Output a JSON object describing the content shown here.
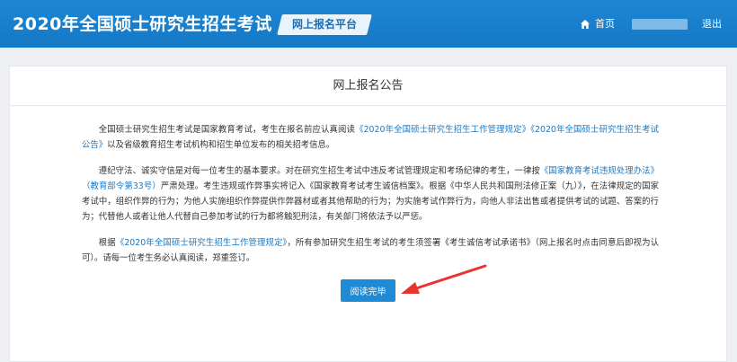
{
  "header": {
    "site_title": "2020年全国硕士研究生招生考试",
    "platform_label": "网上报名平台",
    "home_label": "首页",
    "home_icon": "home-icon",
    "logout_label": "退出",
    "brand_color": "#1a7fce"
  },
  "announcement": {
    "title": "网上报名公告",
    "p1_a": "全国硕士研究生招生考试是国家教育考试，考生在报名前应认真阅读",
    "p1_link1": "《2020年全国硕士研究生招生工作管理规定》",
    "p1_link2": "《2020年全国硕士研究生招生考试公告》",
    "p1_b": "以及省级教育招生考试机构和招生单位发布的相关招考信息。",
    "p2_a": "遵纪守法、诚实守信是对每一位考生的基本要求。对在研究生招生考试中违反考试管理规定和考场纪律的考生，一律按",
    "p2_link1": "《国家教育考试违规处理办法》（教育部令第33号）",
    "p2_b": "严肃处理。考生违规或作弊事实将记入《国家教育考试考生诚信档案》。根据《中华人民共和国刑法修正案（九）》，在法律规定的国家考试中，组织作弊的行为；为他人实施组织作弊提供作弊器材或者其他帮助的行为；为实施考试作弊行为，向他人非法出售或者提供考试的试题、答案的行为；代替他人或者让他人代替自己参加考试的行为都将触犯刑法，有关部门将依法予以严惩。",
    "p3_a": "根据",
    "p3_link1": "《2020年全国硕士研究生招生工作管理规定》",
    "p3_b": "，所有参加研究生招生考试的考生须签署《考生诚信考试承诺书》（网上报名时点击同意后即视为认可）。请每一位考生务必认真阅读，郑重签订。",
    "link_color": "#1a78c2"
  },
  "actions": {
    "read_done_label": "阅读完毕"
  },
  "annotation": {
    "arrow_color": "#e8332f"
  }
}
